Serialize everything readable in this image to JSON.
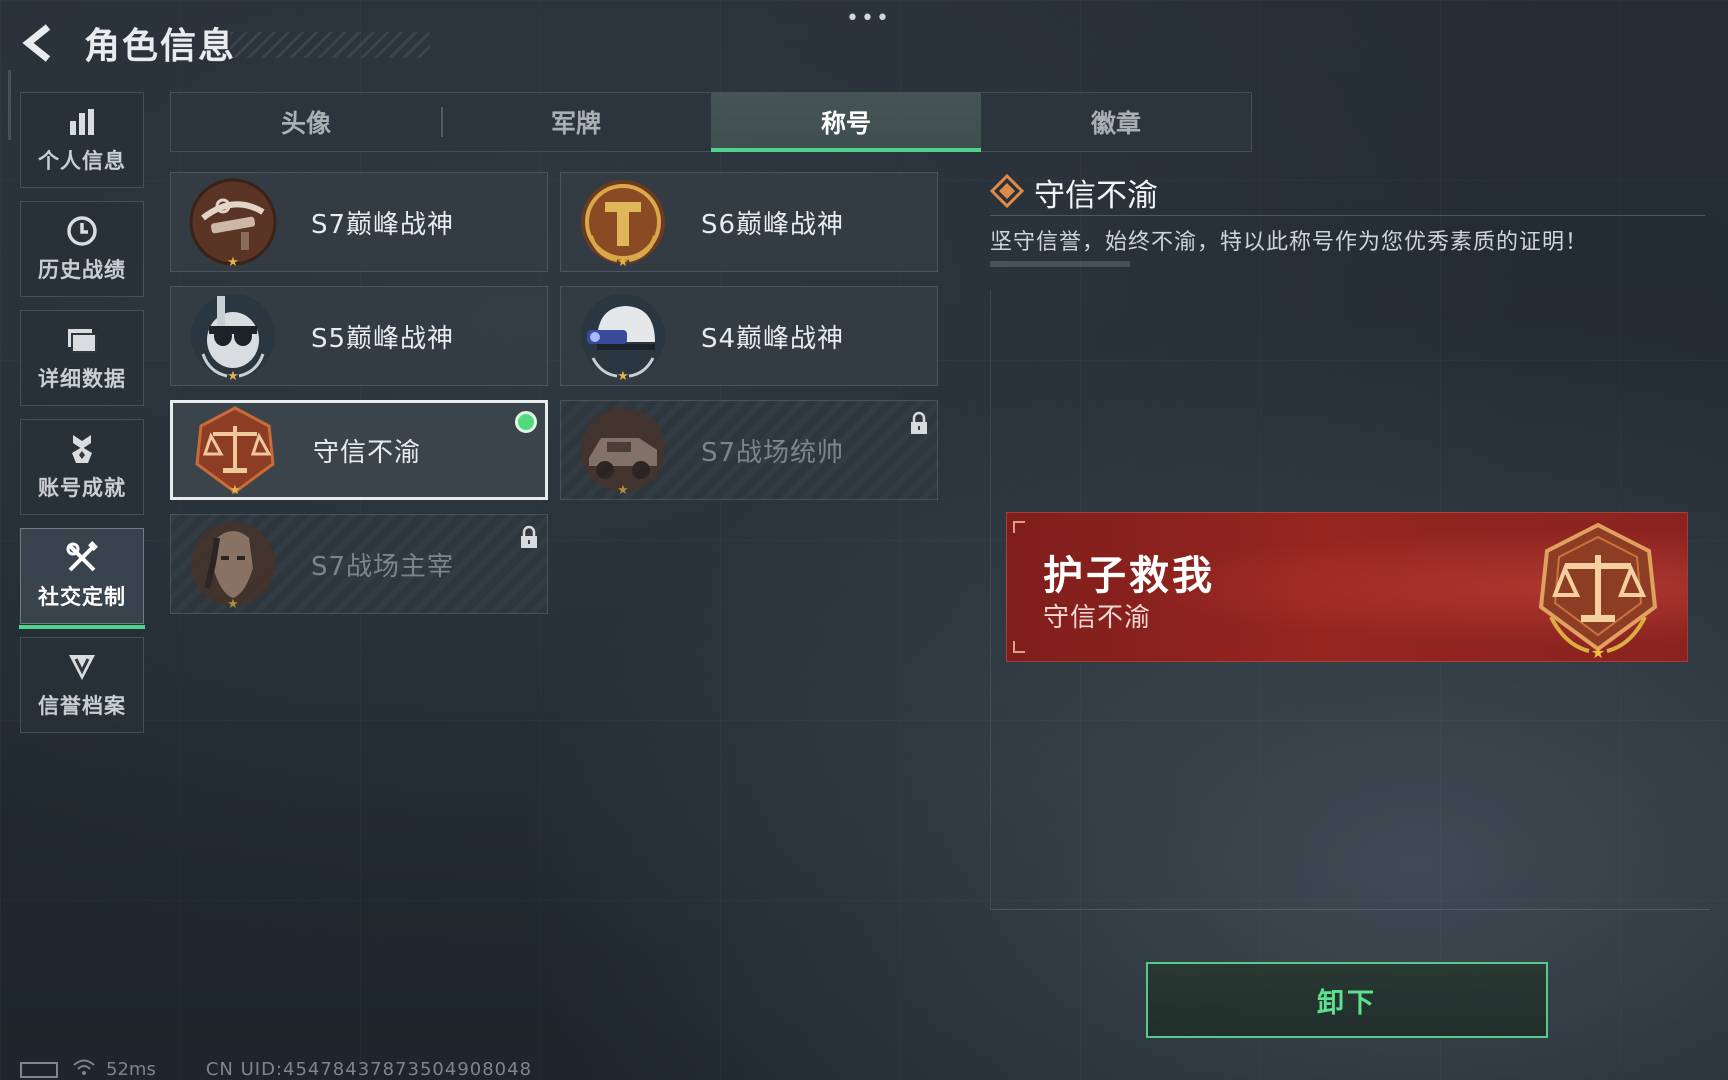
{
  "header": {
    "title": "角色信息",
    "back_icon": "back-arrow-icon",
    "more_icon": "more-dots-icon"
  },
  "sidebar": {
    "items": [
      {
        "label": "个人信息",
        "icon": "bar-chart-icon",
        "active": false
      },
      {
        "label": "历史战绩",
        "icon": "clock-icon",
        "active": false
      },
      {
        "label": "详细数据",
        "icon": "folder-icon",
        "active": false
      },
      {
        "label": "账号成就",
        "icon": "medal-icon",
        "active": false
      },
      {
        "label": "社交定制",
        "icon": "tools-icon",
        "active": true
      },
      {
        "label": "信誉档案",
        "icon": "shield-badge-icon",
        "active": false
      }
    ]
  },
  "tabs": [
    {
      "label": "头像",
      "active": false
    },
    {
      "label": "军牌",
      "active": false
    },
    {
      "label": "称号",
      "active": true
    },
    {
      "label": "徽章",
      "active": false
    }
  ],
  "titles": [
    {
      "name": "S7巅峰战神",
      "emblem": "crossbow-emblem-icon",
      "locked": false,
      "equipped": false
    },
    {
      "name": "S6巅峰战神",
      "emblem": "gold-shield-emblem-icon",
      "locked": false,
      "equipped": false
    },
    {
      "name": "S5巅峰战神",
      "emblem": "diver-skull-emblem-icon",
      "locked": false,
      "equipped": false
    },
    {
      "name": "S4巅峰战神",
      "emblem": "helmet-emblem-icon",
      "locked": false,
      "equipped": false
    },
    {
      "name": "守信不渝",
      "emblem": "scales-emblem-icon",
      "locked": false,
      "equipped": true,
      "selected": true
    },
    {
      "name": "S7战场统帅",
      "emblem": "vehicle-emblem-icon",
      "locked": true,
      "equipped": false
    },
    {
      "name": "S7战场主宰",
      "emblem": "warrior-emblem-icon",
      "locked": true,
      "equipped": false
    }
  ],
  "detail": {
    "title_icon": "diamond-badge-icon",
    "title": "守信不渝",
    "description": "坚守信誉，始终不渝，特以此称号作为您优秀素质的证明！"
  },
  "banner": {
    "player_name": "护子救我",
    "title": "守信不渝",
    "emblem": "scales-emblem-icon"
  },
  "unequip_label": "卸下",
  "status": {
    "ping": "52ms",
    "uid": "CN UID:454784378735049080​48"
  },
  "colors": {
    "accent_green": "#4fd38b",
    "banner_red": "#8f2420",
    "emblem_bronze": "#8a4a2a"
  }
}
